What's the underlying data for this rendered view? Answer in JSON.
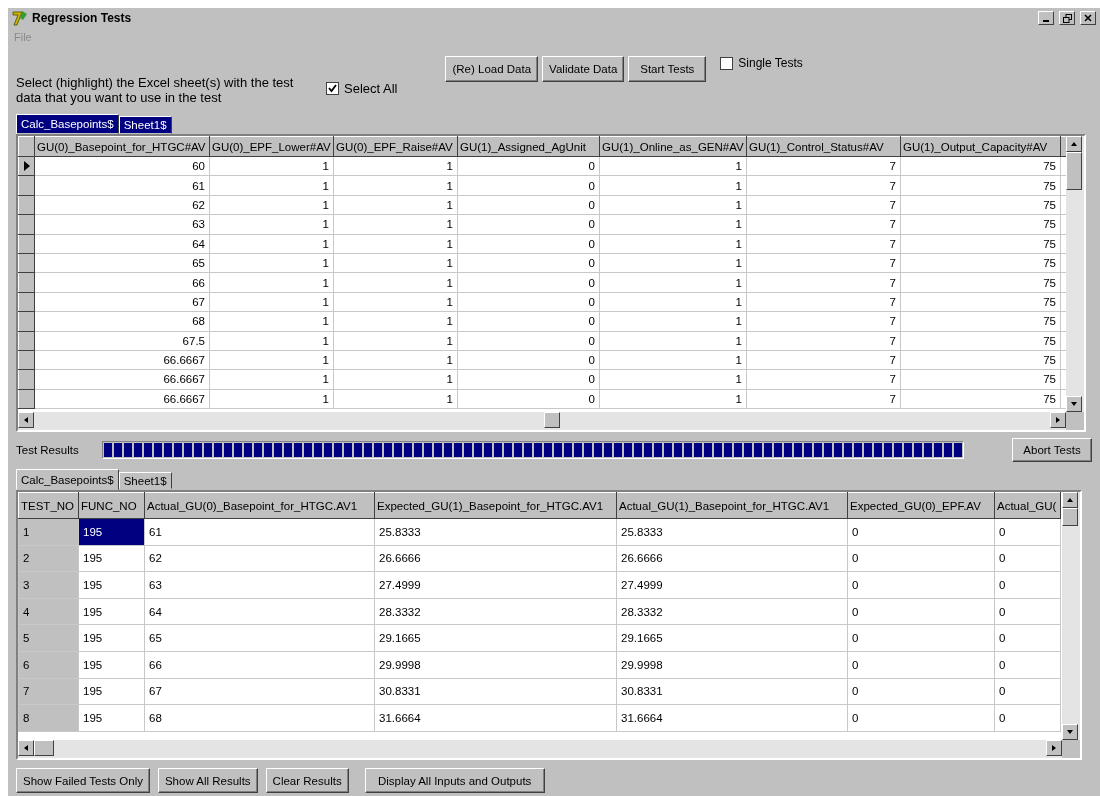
{
  "window": {
    "title": "Regression Tests"
  },
  "menu": [
    {
      "label": "File",
      "disabled": true
    }
  ],
  "instructions": "Select (highlight) the Excel sheet(s) with the test data that you want to use in the test",
  "select_all": {
    "label": "Select All",
    "checked": true
  },
  "toolbar_buttons": [
    "(Re) Load Data",
    "Validate Data",
    "Start Tests"
  ],
  "single_tests": {
    "label": "Single Tests",
    "checked": false
  },
  "input_tabs": [
    {
      "label": "Calc_Basepoints$",
      "selected": true
    },
    {
      "label": "Sheet1$",
      "selected": true
    }
  ],
  "input_table": {
    "columns": [
      "GU(0)_Basepoint_for_HTGC#AV",
      "GU(0)_EPF_Lower#AV",
      "GU(0)_EPF_Raise#AV",
      "GU(1)_Assigned_AgUnit",
      "GU(1)_Online_as_GEN#AV",
      "GU(1)_Control_Status#AV",
      "GU(1)_Output_Capacity#AV"
    ],
    "rows": [
      {
        "current": true,
        "cells": [
          "60",
          "1",
          "1",
          "0",
          "1",
          "7",
          "75"
        ]
      },
      {
        "current": false,
        "cells": [
          "61",
          "1",
          "1",
          "0",
          "1",
          "7",
          "75"
        ]
      },
      {
        "current": false,
        "cells": [
          "62",
          "1",
          "1",
          "0",
          "1",
          "7",
          "75"
        ]
      },
      {
        "current": false,
        "cells": [
          "63",
          "1",
          "1",
          "0",
          "1",
          "7",
          "75"
        ]
      },
      {
        "current": false,
        "cells": [
          "64",
          "1",
          "1",
          "0",
          "1",
          "7",
          "75"
        ]
      },
      {
        "current": false,
        "cells": [
          "65",
          "1",
          "1",
          "0",
          "1",
          "7",
          "75"
        ]
      },
      {
        "current": false,
        "cells": [
          "66",
          "1",
          "1",
          "0",
          "1",
          "7",
          "75"
        ]
      },
      {
        "current": false,
        "cells": [
          "67",
          "1",
          "1",
          "0",
          "1",
          "7",
          "75"
        ]
      },
      {
        "current": false,
        "cells": [
          "68",
          "1",
          "1",
          "0",
          "1",
          "7",
          "75"
        ]
      },
      {
        "current": false,
        "cells": [
          "67.5",
          "1",
          "1",
          "0",
          "1",
          "7",
          "75"
        ]
      },
      {
        "current": false,
        "cells": [
          "66.6667",
          "1",
          "1",
          "0",
          "1",
          "7",
          "75"
        ]
      },
      {
        "current": false,
        "cells": [
          "66.6667",
          "1",
          "1",
          "0",
          "1",
          "7",
          "75"
        ]
      },
      {
        "current": false,
        "cells": [
          "66.6667",
          "1",
          "1",
          "0",
          "1",
          "7",
          "75"
        ]
      }
    ]
  },
  "progress": {
    "label": "Test Results",
    "level": 1
  },
  "abort_button": "Abort Tests",
  "result_tabs": [
    {
      "label": "Calc_Basepoints$",
      "selected": true
    },
    {
      "label": "Sheet1$",
      "selected": false
    }
  ],
  "results_table": {
    "columns": [
      "TEST_NO",
      "FUNC_NO",
      "Actual_GU(0)_Basepoint_for_HTGC.AV1",
      "Expected_GU(1)_Basepoint_for_HTGC.AV1",
      "Actual_GU(1)_Basepoint_for_HTGC.AV1",
      "Expected_GU(0)_EPF.AV",
      "Actual_GU("
    ],
    "rows": [
      {
        "cells": [
          {
            "text": "1",
            "selected": false
          },
          {
            "text": "195",
            "selected": true
          },
          {
            "text": "61",
            "selected": false
          },
          {
            "text": "25.8333",
            "selected": false
          },
          {
            "text": "25.8333",
            "selected": false
          },
          {
            "text": "0",
            "selected": false
          },
          {
            "text": "0",
            "selected": false
          }
        ]
      },
      {
        "cells": [
          {
            "text": "2",
            "selected": false
          },
          {
            "text": "195",
            "selected": false
          },
          {
            "text": "62",
            "selected": false
          },
          {
            "text": "26.6666",
            "selected": false
          },
          {
            "text": "26.6666",
            "selected": false
          },
          {
            "text": "0",
            "selected": false
          },
          {
            "text": "0",
            "selected": false
          }
        ]
      },
      {
        "cells": [
          {
            "text": "3",
            "selected": false
          },
          {
            "text": "195",
            "selected": false
          },
          {
            "text": "63",
            "selected": false
          },
          {
            "text": "27.4999",
            "selected": false
          },
          {
            "text": "27.4999",
            "selected": false
          },
          {
            "text": "0",
            "selected": false
          },
          {
            "text": "0",
            "selected": false
          }
        ]
      },
      {
        "cells": [
          {
            "text": "4",
            "selected": false
          },
          {
            "text": "195",
            "selected": false
          },
          {
            "text": "64",
            "selected": false
          },
          {
            "text": "28.3332",
            "selected": false
          },
          {
            "text": "28.3332",
            "selected": false
          },
          {
            "text": "0",
            "selected": false
          },
          {
            "text": "0",
            "selected": false
          }
        ]
      },
      {
        "cells": [
          {
            "text": "5",
            "selected": false
          },
          {
            "text": "195",
            "selected": false
          },
          {
            "text": "65",
            "selected": false
          },
          {
            "text": "29.1665",
            "selected": false
          },
          {
            "text": "29.1665",
            "selected": false
          },
          {
            "text": "0",
            "selected": false
          },
          {
            "text": "0",
            "selected": false
          }
        ]
      },
      {
        "cells": [
          {
            "text": "6",
            "selected": false
          },
          {
            "text": "195",
            "selected": false
          },
          {
            "text": "66",
            "selected": false
          },
          {
            "text": "29.9998",
            "selected": false
          },
          {
            "text": "29.9998",
            "selected": false
          },
          {
            "text": "0",
            "selected": false
          },
          {
            "text": "0",
            "selected": false
          }
        ]
      },
      {
        "cells": [
          {
            "text": "7",
            "selected": false
          },
          {
            "text": "195",
            "selected": false
          },
          {
            "text": "67",
            "selected": false
          },
          {
            "text": "30.8331",
            "selected": false
          },
          {
            "text": "30.8331",
            "selected": false
          },
          {
            "text": "0",
            "selected": false
          },
          {
            "text": "0",
            "selected": false
          }
        ]
      },
      {
        "cells": [
          {
            "text": "8",
            "selected": false
          },
          {
            "text": "195",
            "selected": false
          },
          {
            "text": "68",
            "selected": false
          },
          {
            "text": "31.6664",
            "selected": false
          },
          {
            "text": "31.6664",
            "selected": false
          },
          {
            "text": "0",
            "selected": false
          },
          {
            "text": "0",
            "selected": false
          }
        ]
      }
    ]
  },
  "bottom_buttons": [
    "Show Failed Tests Only",
    "Show All Results",
    "Clear Results",
    "Display All Inputs and Outputs"
  ]
}
